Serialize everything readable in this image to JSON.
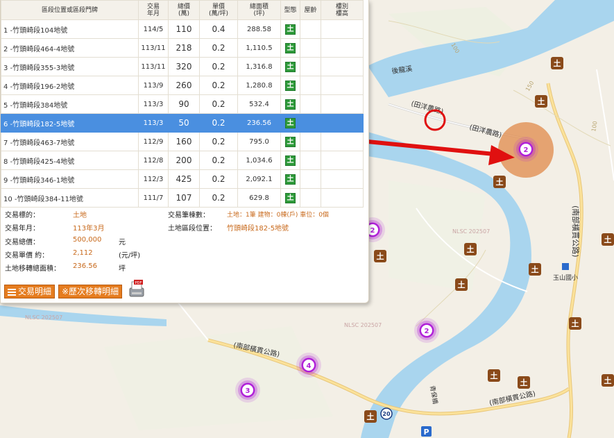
{
  "table": {
    "headers": [
      "區段位置或區段門牌",
      "交易\n年月",
      "總價\n(萬)",
      "單價\n(萬/坪)",
      "總面積\n(坪)",
      "型態",
      "屋齡",
      "樓別\n樓高"
    ],
    "rows": [
      {
        "loc": "1 -竹頭崎段104地號",
        "date": "114/5",
        "total": "110",
        "unit": "0.4",
        "area": "288.58",
        "type": "土"
      },
      {
        "loc": "2 -竹頭崎段464-4地號",
        "date": "113/11",
        "total": "218",
        "unit": "0.2",
        "area": "1,110.5",
        "type": "土"
      },
      {
        "loc": "3 -竹頭崎段355-3地號",
        "date": "113/11",
        "total": "320",
        "unit": "0.2",
        "area": "1,316.8",
        "type": "土"
      },
      {
        "loc": "4 -竹頭崎段196-2地號",
        "date": "113/9",
        "total": "260",
        "unit": "0.2",
        "area": "1,280.8",
        "type": "土"
      },
      {
        "loc": "5 -竹頭崎段384地號",
        "date": "113/3",
        "total": "90",
        "unit": "0.2",
        "area": "532.4",
        "type": "土"
      },
      {
        "loc": "6 -竹頭崎段182-5地號",
        "date": "113/3",
        "total": "50",
        "unit": "0.2",
        "area": "236.56",
        "type": "土"
      },
      {
        "loc": "7 -竹頭崎段463-7地號",
        "date": "112/9",
        "total": "160",
        "unit": "0.2",
        "area": "795.0",
        "type": "土"
      },
      {
        "loc": "8 -竹頭崎段425-4地號",
        "date": "112/8",
        "total": "200",
        "unit": "0.2",
        "area": "1,034.6",
        "type": "土"
      },
      {
        "loc": "9 -竹頭崎段346-1地號",
        "date": "112/3",
        "total": "425",
        "unit": "0.2",
        "area": "2,092.1",
        "type": "土"
      },
      {
        "loc": "10 -竹頭崎段384-11地號",
        "date": "111/7",
        "total": "107",
        "unit": "0.2",
        "area": "629.8",
        "type": "土"
      }
    ],
    "selected_index": 5
  },
  "detail": {
    "target_label": "交易標的：",
    "target_value": "土地",
    "date_label": "交易年月：",
    "date_value": "113年3月",
    "total_label": "交易總價：",
    "total_value": "500,000",
    "total_unit": "元",
    "unit_label": "交易單價 約：",
    "unit_value": "2,112",
    "unit_unit": "(元/坪)",
    "area_label": "土地移轉總面積：",
    "area_value": "236.56",
    "area_unit": "坪",
    "count_label": "交易筆棟數：",
    "count_value": "土地：1筆 建物：0棟(戶) 車位：0個",
    "loc_label": "土地區段位置：",
    "loc_value": "竹頭崎段182-5地號",
    "btn_detail": "交易明細",
    "btn_history": "※歷次移轉明細"
  },
  "map": {
    "labels": {
      "road_tianyang_1": "(田洋農路)",
      "road_tianyang_2": "(田洋農路)",
      "creek": "後龍溪",
      "road_south_vertical": "(南部橫貫公路)",
      "road_south_left": "(南部橫貫公路)",
      "road_south_bottom": "(南部橫貫公路)",
      "school": "玉山國小",
      "nlsc_1": "NLSC 202507",
      "nlsc_2": "NLSC 202507",
      "nlsc_3": "NLSC 202507",
      "contour_100_a": "100",
      "contour_100_b": "100",
      "contour_150": "150",
      "road_num": "20",
      "bottom_text": "青保橋"
    },
    "clusters": [
      {
        "count": "2"
      },
      {
        "count": "2"
      },
      {
        "count": "2"
      },
      {
        "count": "4"
      },
      {
        "count": "3"
      }
    ],
    "land_marker_glyph": "土",
    "colors": {
      "cluster": "#b020d8",
      "marker": "#8a4a1a",
      "river": "#a9d5ee",
      "arrow": "#e01010",
      "highlight": "#e08a4a"
    }
  }
}
